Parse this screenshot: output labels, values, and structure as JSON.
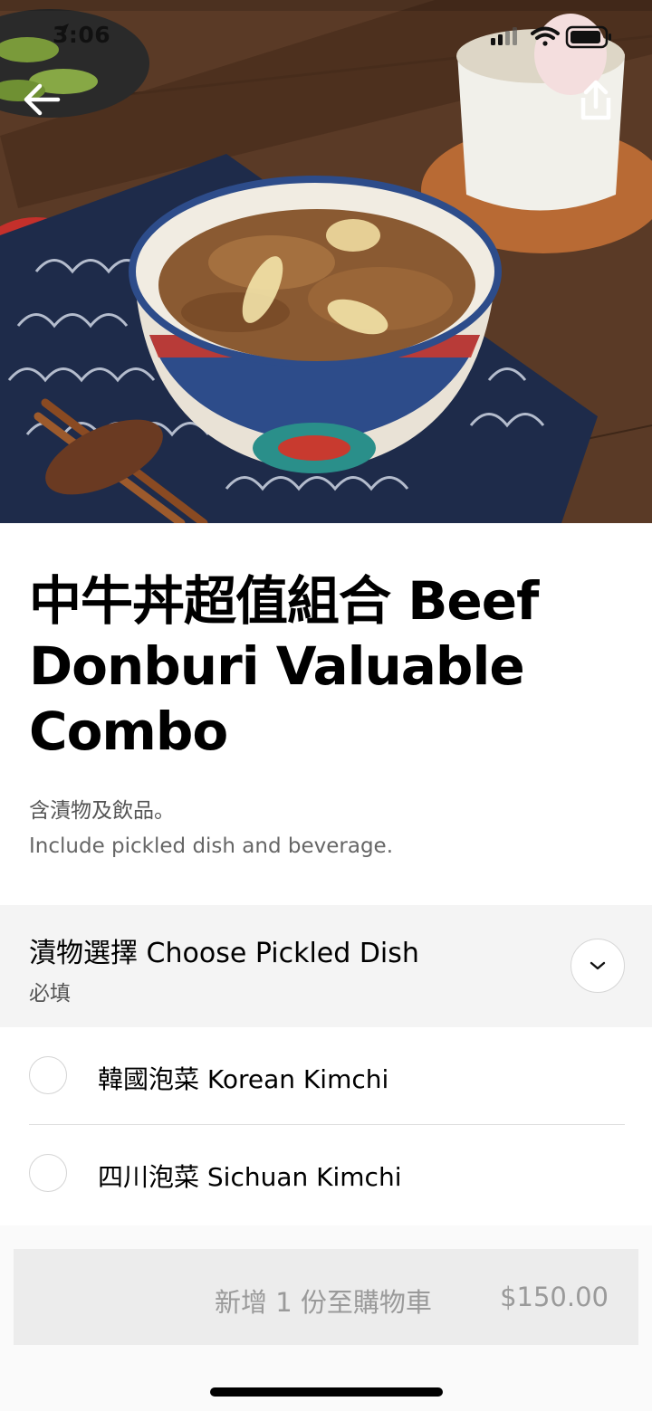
{
  "status_bar": {
    "time": "3:06"
  },
  "item": {
    "title": "中牛丼超值組合 Beef Donburi Valuable Combo",
    "description_zh": "含漬物及飲品。",
    "description_en": "Include pickled dish and beverage."
  },
  "option_group": {
    "title": "漬物選擇 Choose Pickled Dish",
    "required_label": "必填",
    "options": [
      {
        "label": "韓國泡菜 Korean Kimchi"
      },
      {
        "label": "四川泡菜 Sichuan Kimchi"
      }
    ]
  },
  "cart_button": {
    "label": "新增 1 份至購物車",
    "price": "$150.00"
  },
  "icons": {
    "back": "arrow-left-icon",
    "share": "share-icon",
    "expand": "chevron-down-icon",
    "location": "location-arrow-icon",
    "signal": "signal-icon",
    "wifi": "wifi-icon",
    "battery": "battery-icon"
  },
  "colors": {
    "accent": "#000000",
    "disabled_text": "#9a9a9a",
    "section_bg": "#f4f4f4"
  }
}
